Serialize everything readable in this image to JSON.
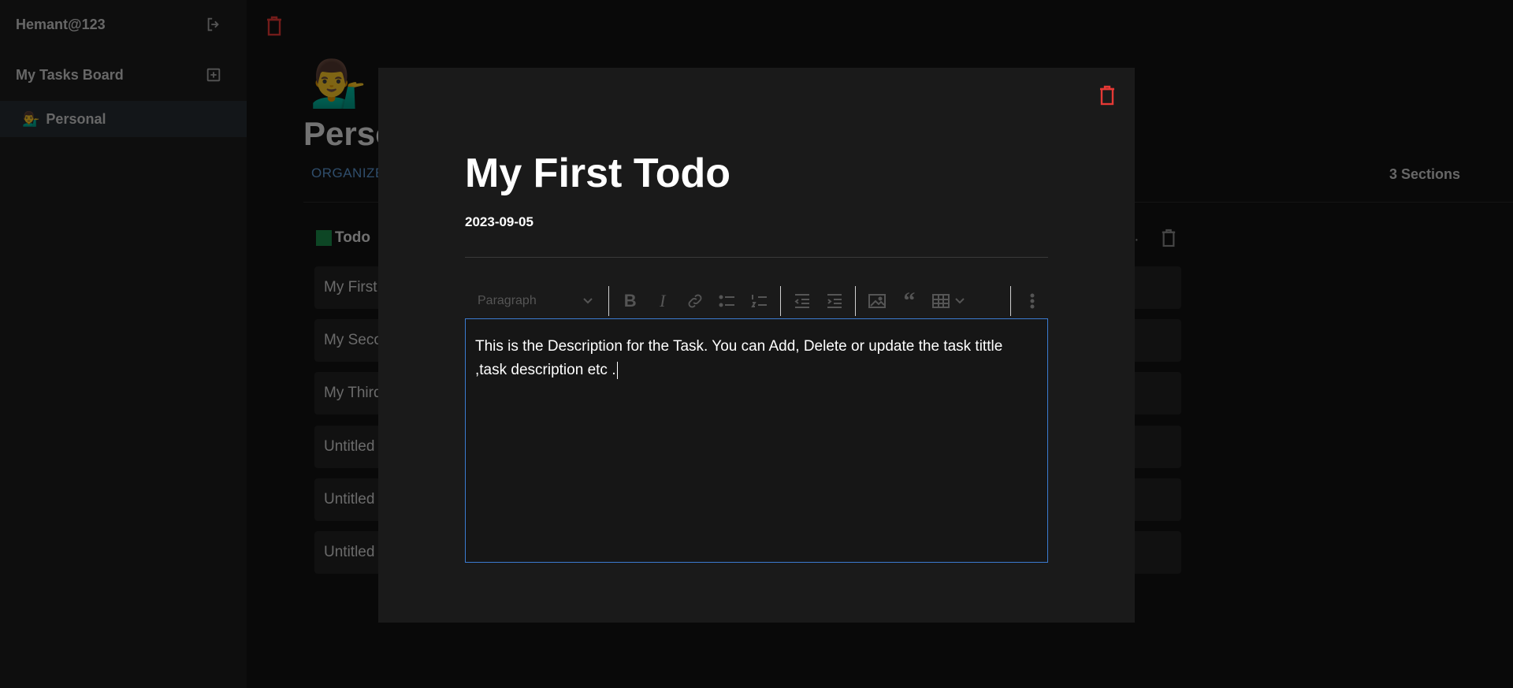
{
  "sidebar": {
    "username": "Hemant@123",
    "board_label": "My Tasks Board",
    "items": [
      {
        "emoji": "💁‍♂️",
        "label": "Personal",
        "active": true
      }
    ]
  },
  "board": {
    "emoji": "💁‍♂️",
    "title": "Perso",
    "organize_label": "ORGANIZE",
    "sections_count": "3 Sections",
    "section": {
      "color": "#1a8c4a",
      "name": "Todo",
      "tasks": [
        "My First",
        "My Seco",
        "My Third",
        "Untitled",
        "Untitled",
        "Untitled"
      ]
    }
  },
  "modal": {
    "title": "My First Todo",
    "date": "2023-09-05",
    "toolbar": {
      "heading_select": "Paragraph",
      "buttons": [
        "bold",
        "italic",
        "link",
        "bulleted-list",
        "numbered-list",
        "outdent",
        "indent",
        "image",
        "block-quote",
        "table",
        "more"
      ]
    },
    "description": "This is the Description for the Task. You can Add, Delete or update the task tittle ,task description etc ."
  },
  "colors": {
    "danger": "#e53935",
    "accent_blue": "#3b7bd1",
    "organize_blue": "#5f9bd6",
    "section_green": "#1a8c4a"
  },
  "icons": {
    "logout": "logout-icon",
    "add_board": "add-box-icon",
    "delete": "trash-icon"
  }
}
